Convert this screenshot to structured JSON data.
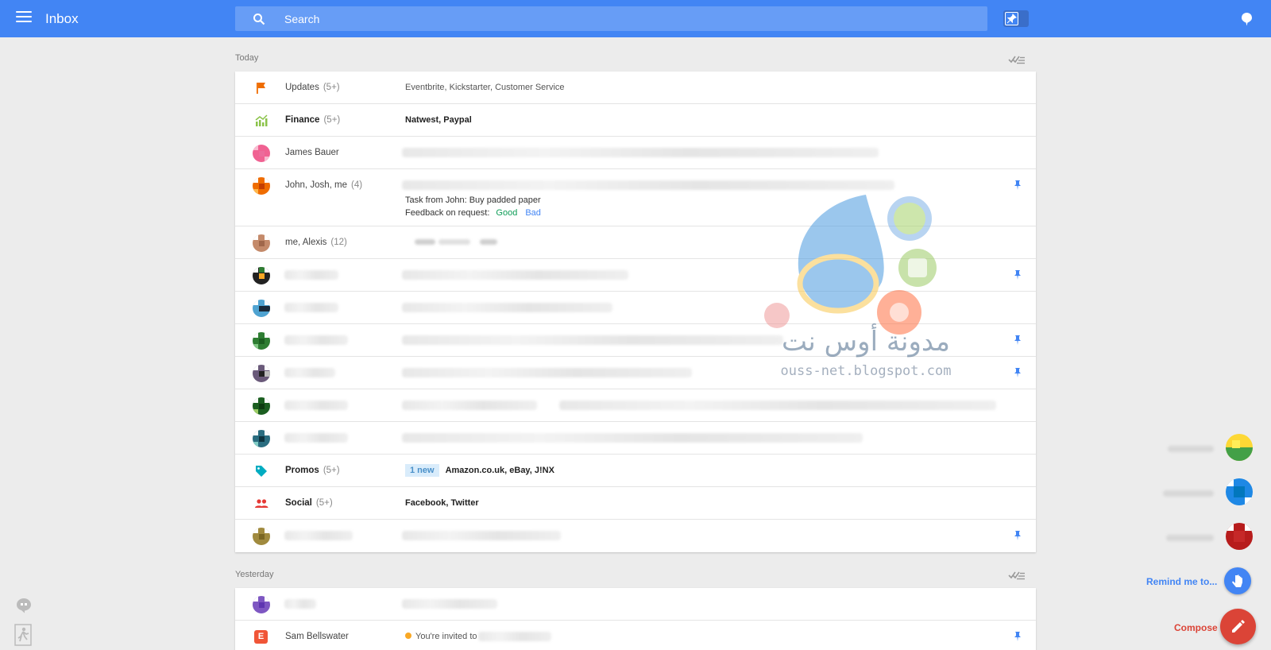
{
  "header": {
    "title": "Inbox",
    "search_placeholder": "Search"
  },
  "sections": {
    "today": "Today",
    "yesterday": "Yesterday"
  },
  "rows": {
    "updates": {
      "sender": "Updates",
      "count": "(5+)",
      "subject": "Eventbrite, Kickstarter, Customer Service"
    },
    "finance": {
      "sender": "Finance",
      "count": "(5+)",
      "subject": "Natwest, Paypal"
    },
    "james": {
      "sender": "James Bauer"
    },
    "john": {
      "sender": "John, Josh, me",
      "count": "(4)",
      "task": "Task from John: Buy padded paper",
      "feedback_label": "Feedback on request:",
      "good": "Good",
      "bad": "Bad"
    },
    "alexis": {
      "sender": "me, Alexis",
      "count": "(12)"
    },
    "promos": {
      "sender": "Promos",
      "count": "(5+)",
      "badge": "1 new",
      "subject": "Amazon.co.uk, eBay, J!NX"
    },
    "social": {
      "sender": "Social",
      "count": "(5+)",
      "subject": "Facebook, Twitter"
    },
    "sam": {
      "sender": "Sam Bellswater",
      "subject": "You're invited to"
    }
  },
  "watermark": {
    "arabic": "مدونة أوس نت",
    "url": "ouss-net.blogspot.com"
  },
  "actions": {
    "remind": "Remind me to...",
    "compose": "Compose"
  },
  "colors": {
    "header": "#4285f4",
    "compose": "#db4437",
    "updates_flag": "#ef6c00",
    "finance": "#8bc34a",
    "promos": "#00acc1",
    "social": "#e53935"
  }
}
